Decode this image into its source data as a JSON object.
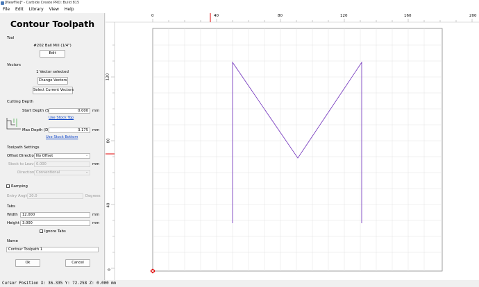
{
  "window": {
    "title": "[NewFile]* - Carbide Create PRO: Build 815"
  },
  "menu": [
    "File",
    "Edit",
    "Library",
    "View",
    "Help"
  ],
  "panel": {
    "title": "Contour Toolpath",
    "tool": {
      "heading": "Tool",
      "name": "#202 Ball Mill (1/4\")",
      "edit_label": "Edit"
    },
    "vectors": {
      "heading": "Vectors",
      "selected_text": "1 Vector selected",
      "change_label": "Change Vectors",
      "select_current_label": "Select Current Vectors"
    },
    "cutting_depth": {
      "heading": "Cutting Depth",
      "start_label": "Start Depth (S)",
      "start_value": "0.000",
      "start_unit": "mm",
      "use_stock_top": "Use Stock Top",
      "max_label": "Max Depth (D)",
      "max_value": "3.175",
      "max_unit": "mm",
      "use_stock_bottom": "Use Stock Bottom"
    },
    "toolpath_settings": {
      "heading": "Toolpath Settings",
      "offset_label": "Offset Direction",
      "offset_value": "No Offset",
      "stock_label": "Stock to Leave",
      "stock_value": "0.000",
      "stock_unit": "mm",
      "direction_label": "Direction",
      "direction_value": "Conventional"
    },
    "ramping": {
      "label": "Ramping",
      "entry_label": "Entry Angle",
      "entry_value": "20.0",
      "entry_unit": "Degrees"
    },
    "tabs": {
      "heading": "Tabs",
      "width_label": "Width",
      "width_value": "12.000",
      "width_unit": "mm",
      "height_label": "Height",
      "height_value": "3.000",
      "height_unit": "mm",
      "ignore_label": "Ignore Tabs"
    },
    "name": {
      "heading": "Name",
      "value": "Contour Toolpath 1"
    },
    "ok_label": "Ok",
    "cancel_label": "Cancel"
  },
  "ruler": {
    "x_labels": [
      "0",
      "40",
      "80",
      "120",
      "160",
      "200"
    ],
    "y_labels": [
      "120",
      "80",
      "40",
      "0"
    ]
  },
  "canvas": {
    "path_color": "#7a3fc0",
    "accent": "#e00000"
  },
  "status": {
    "text": "Cursor Position X: 36.335 Y: 72.258 Z: 0.000 mm"
  }
}
